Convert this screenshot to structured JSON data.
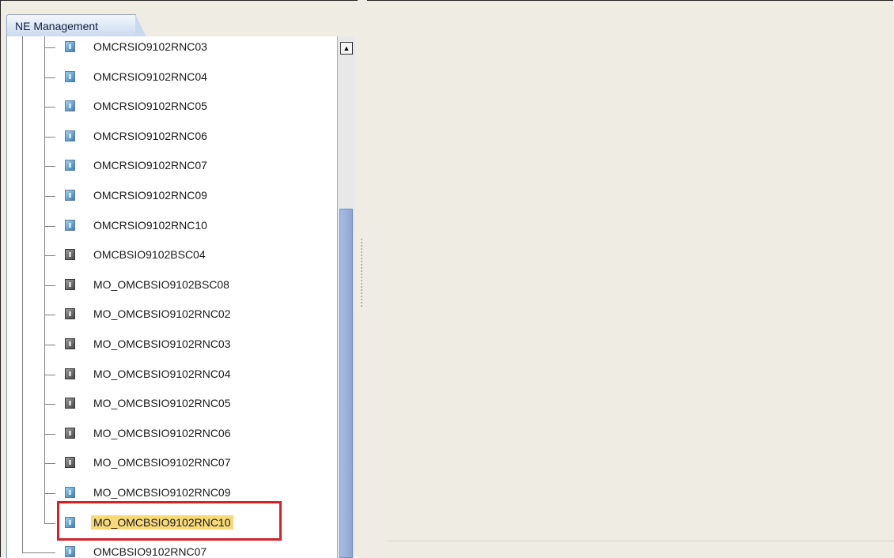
{
  "panel": {
    "tab_label": "NE Management"
  },
  "tree": {
    "items": [
      {
        "label": "OMCRSIO9102RNC03",
        "icon": "blue"
      },
      {
        "label": "OMCRSIO9102RNC04",
        "icon": "blue"
      },
      {
        "label": "OMCRSIO9102RNC05",
        "icon": "blue"
      },
      {
        "label": "OMCRSIO9102RNC06",
        "icon": "blue"
      },
      {
        "label": "OMCRSIO9102RNC07",
        "icon": "blue"
      },
      {
        "label": "OMCRSIO9102RNC09",
        "icon": "blue"
      },
      {
        "label": "OMCRSIO9102RNC10",
        "icon": "blue"
      },
      {
        "label": "OMCBSIO9102BSC04",
        "icon": "gray"
      },
      {
        "label": "MO_OMCBSIO9102BSC08",
        "icon": "gray"
      },
      {
        "label": "MO_OMCBSIO9102RNC02",
        "icon": "gray"
      },
      {
        "label": "MO_OMCBSIO9102RNC03",
        "icon": "gray"
      },
      {
        "label": "MO_OMCBSIO9102RNC04",
        "icon": "gray"
      },
      {
        "label": "MO_OMCBSIO9102RNC05",
        "icon": "gray"
      },
      {
        "label": "MO_OMCBSIO9102RNC06",
        "icon": "gray"
      },
      {
        "label": "MO_OMCBSIO9102RNC07",
        "icon": "gray"
      },
      {
        "label": "MO_OMCBSIO9102RNC09",
        "icon": "blue"
      },
      {
        "label": "MO_OMCBSIO9102RNC10",
        "icon": "blue",
        "selected": true
      },
      {
        "label": "OMCBSIO9102RNC07",
        "icon": "blue"
      }
    ]
  },
  "colors": {
    "selection": "#f7d97a",
    "highlight_border": "#d2232a",
    "scroll_thumb": "#a7bce0",
    "tab": "#c9d9ef"
  }
}
